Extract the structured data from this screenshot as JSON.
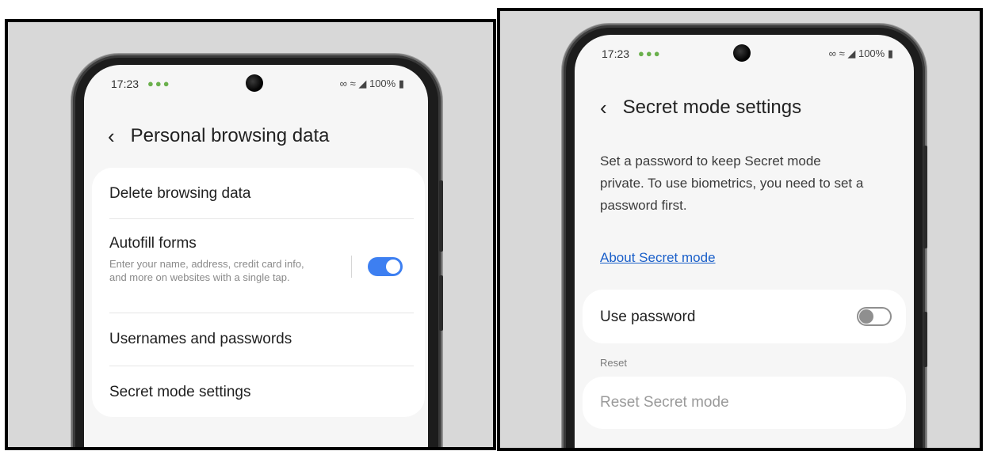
{
  "left": {
    "status": {
      "time": "17:23",
      "android_icons": "⚙⚙⚙",
      "right_text": "100%"
    },
    "title": "Personal browsing data",
    "items": [
      {
        "label": "Delete browsing data"
      },
      {
        "label": "Autofill forms",
        "subtext": "Enter your name, address, credit card info, and more on websites with a single tap.",
        "toggle": "on"
      },
      {
        "label": "Usernames and passwords"
      },
      {
        "label": "Secret mode settings"
      }
    ]
  },
  "right": {
    "status": {
      "time": "17:23",
      "android_icons": "⚙⚙⚙",
      "right_text": "100%"
    },
    "title": "Secret mode settings",
    "description_line1": "Set a password to keep Secret mode",
    "description_line2": "private. To use biometrics, you need to set a",
    "description_line3": "password first.",
    "link": "About Secret mode",
    "use_password": {
      "label": "Use password",
      "toggle": "off"
    },
    "section_label": "Reset",
    "reset_item": "Reset Secret mode"
  },
  "colors": {
    "toggle_on": "#3d7ff1",
    "link": "#1a5fc9",
    "android_green": "#6ab04c"
  }
}
